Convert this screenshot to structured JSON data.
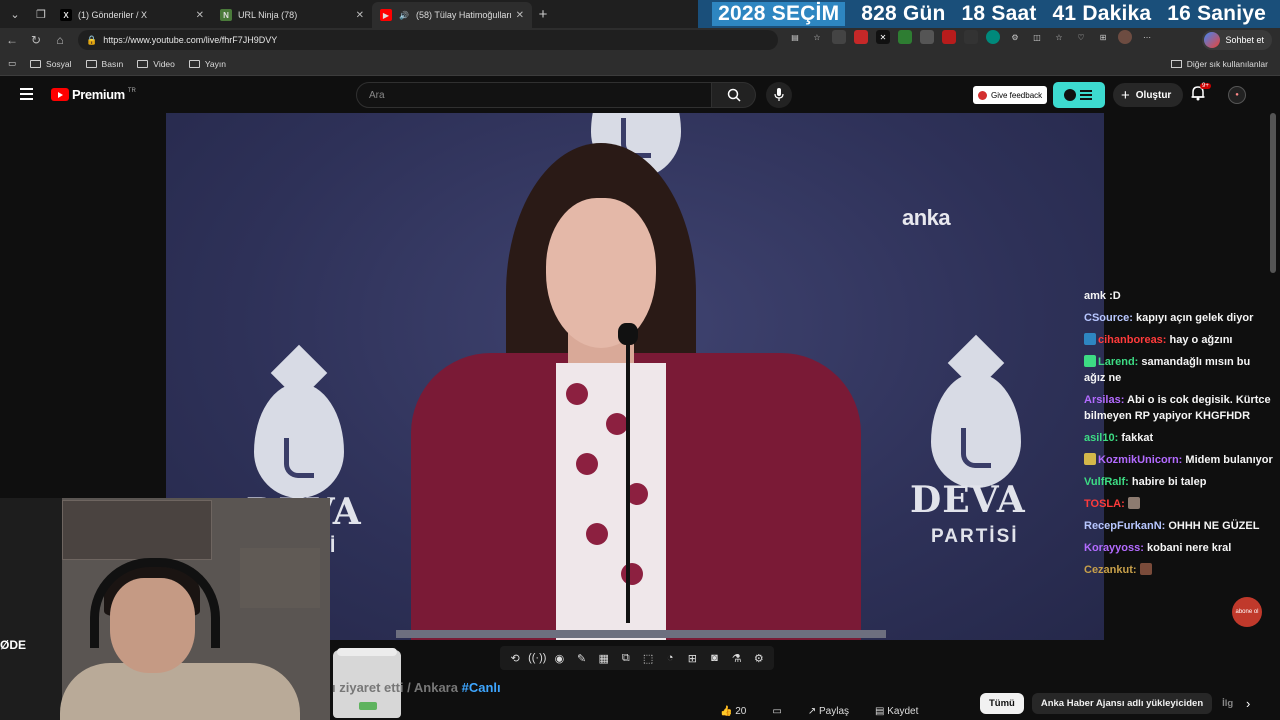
{
  "browser": {
    "tabs": [
      {
        "title": "(1) Gönderiler / X",
        "favicon": "x-icon"
      },
      {
        "title": "URL Ninja (78)",
        "favicon": "ninja-icon"
      },
      {
        "title": "(58) Tülay Hatimoğulları ve Tü",
        "favicon": "youtube-icon"
      }
    ],
    "countdown": {
      "year": "2028",
      "label": "SEÇİM",
      "days": "828",
      "days_unit": "Gün",
      "hours": "18",
      "hours_unit": "Saat",
      "minutes": "41",
      "minutes_unit": "Dakika",
      "seconds": "16",
      "seconds_unit": "Saniye"
    },
    "url": "https://www.youtube.com/live/fhrF7JH9DVY",
    "profile_label": "Sohbet et",
    "bookmarks": [
      "Sosyal",
      "Basın",
      "Video",
      "Yayın"
    ],
    "bookmarks_other": "Diğer sık kullanılanlar"
  },
  "youtube": {
    "logo_text": "Premium",
    "logo_region": "TR",
    "search_placeholder": "Ara",
    "feedback_label": "Give feedback",
    "create_label": "Oluştur",
    "notif_count": "9+",
    "video_title_faded": "ı ziyaret etti / Ankara",
    "video_title_tag": "#Canlı",
    "chips": [
      "Tümü",
      "Anka Haber Ajansı adlı yükleyiciden",
      "İlg"
    ],
    "actions": [
      "20",
      "",
      "Paylaş",
      "Kaydet"
    ]
  },
  "video": {
    "brand_left": "DEVA",
    "brand_right": "DEVA",
    "brand_sub_right": "PARTİSİ",
    "brand_sub_left": "İ",
    "watermark": "anka"
  },
  "webcam_label": "ØDE",
  "chat": [
    {
      "user": "",
      "text": "amk :D",
      "color": "#ffffff"
    },
    {
      "user": "CSource:",
      "text": "kapıyı açın gelek diyor",
      "color": "#b8c7ff"
    },
    {
      "user": "cihanboreas:",
      "text": "hay o ağzını",
      "color": "#ff3b3b"
    },
    {
      "user": "Larend:",
      "text": "samandağlı mısın bu ağız ne",
      "color": "#3ddc84"
    },
    {
      "user": "Arsilas:",
      "text": "Abi o is cok degisik. Kürtce bilmeyen RP yapiyor KHGFHDR",
      "color": "#b36bff"
    },
    {
      "user": "asil10:",
      "text": "fakkat",
      "color": "#3ddc84"
    },
    {
      "user": "KozmikUnicorn:",
      "text": "Midem bulanıyor",
      "color": "#b36bff"
    },
    {
      "user": "VulfRalf:",
      "text": "habire bi talep",
      "color": "#3ddc84"
    },
    {
      "user": "TOSLA:",
      "text": "",
      "color": "#ff3b3b"
    },
    {
      "user": "RecepFurkanN:",
      "text": "OHHH NE GÜZEL",
      "color": "#b8c7ff"
    },
    {
      "user": "Korayyoss:",
      "text": "kobani nere kral",
      "color": "#b36bff"
    },
    {
      "user": "Cezankut:",
      "text": "",
      "color": "#c8a04a"
    }
  ],
  "abone_label": "abone ol"
}
